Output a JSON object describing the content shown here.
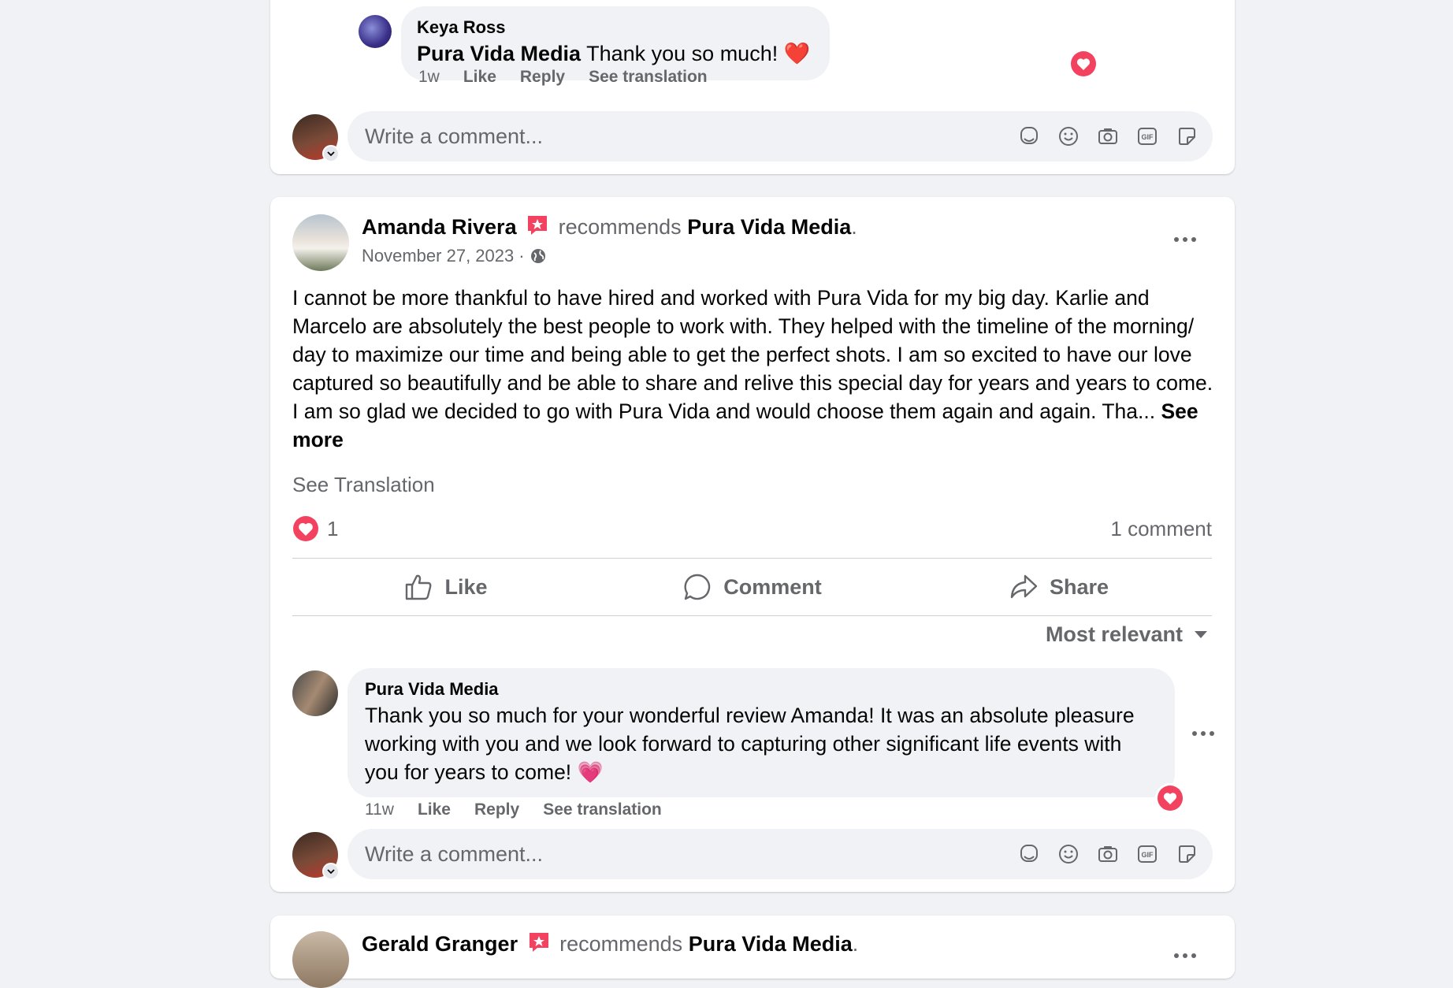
{
  "top_card": {
    "comment": {
      "author": "Keya Ross",
      "mention": "Pura Vida Media",
      "text": "Thank you so much!",
      "emoji": "❤️",
      "time": "1w",
      "like": "Like",
      "reply": "Reply",
      "see_translation": "See translation"
    },
    "composer_placeholder": "Write a comment..."
  },
  "post": {
    "author": "Amanda Rivera",
    "recommends": "recommends",
    "page": "Pura Vida Media",
    "period": ".",
    "date": "November 27, 2023",
    "separator": "·",
    "body": "I cannot be more thankful to have hired and worked with Pura Vida for my big day. Karlie and Marcelo are absolutely the best people to work with. They helped with the timeline of the morning/ day to maximize our time and being able to get the perfect shots. I am so excited to have our love captured so beautifully and be able to share and relive this special day for years and years to come. I am so glad we decided to go with Pura Vida and would choose them again and again. Tha...",
    "see_more": "See more",
    "see_translation": "See Translation",
    "reaction_count": "1",
    "comment_count": "1 comment",
    "actions": {
      "like": "Like",
      "comment": "Comment",
      "share": "Share"
    },
    "sort_label": "Most relevant",
    "reply": {
      "author": "Pura Vida Media",
      "text": "Thank you so much for your wonderful review Amanda! It was an absolute pleasure working with you and we look forward to capturing other significant life events with you for years to come!",
      "emoji": "💗",
      "time": "11w",
      "like": "Like",
      "reply": "Reply",
      "see_translation": "See translation"
    },
    "composer_placeholder": "Write a comment..."
  },
  "next_post": {
    "author": "Gerald Granger",
    "recommends": "recommends",
    "page": "Pura Vida Media",
    "period": "."
  },
  "colors": {
    "heart": "#e41e3f",
    "recommend_badge": "#f3425f",
    "muted": "#65676b",
    "background": "#f0f2f5"
  }
}
